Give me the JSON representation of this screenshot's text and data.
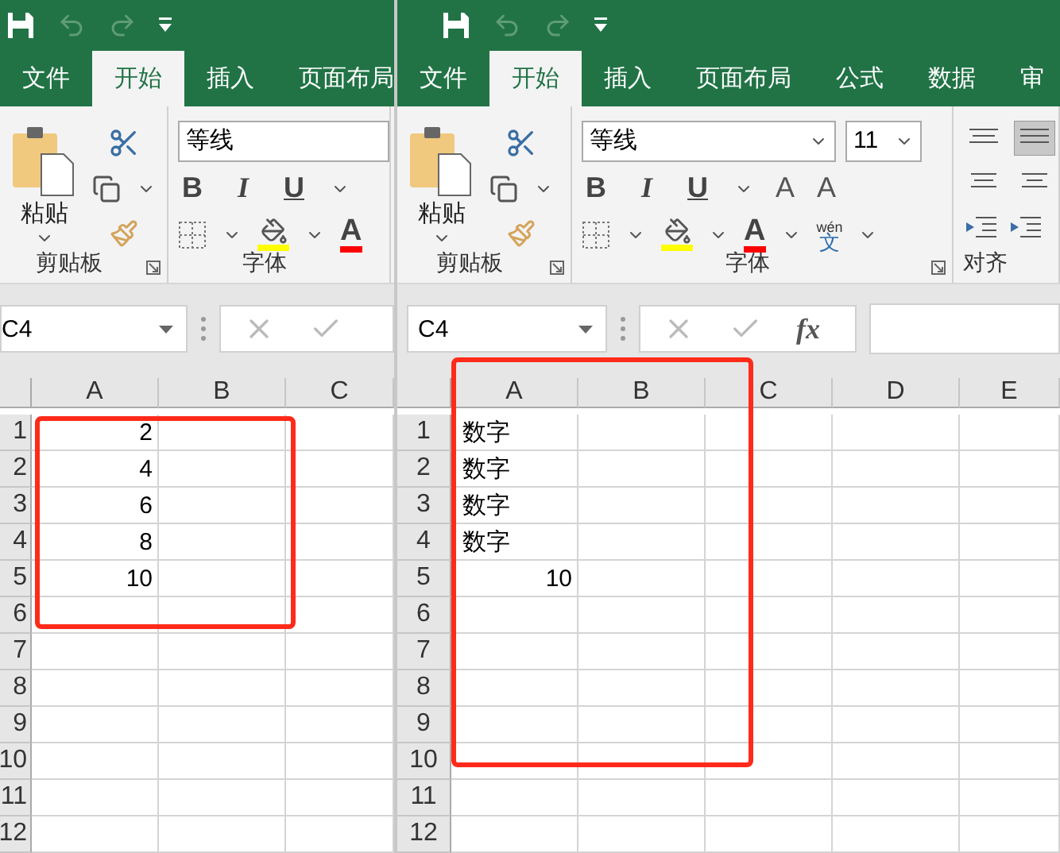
{
  "windows": [
    {
      "tabs": [
        {
          "label": "文件",
          "selected": false
        },
        {
          "label": "开始",
          "selected": true
        },
        {
          "label": "插入",
          "selected": false
        },
        {
          "label": "页面布局",
          "selected": false
        }
      ],
      "paste_label": "粘贴",
      "font_name": "等线",
      "format_buttons": [
        "B",
        "I",
        "U"
      ],
      "font_color_label": "A",
      "groups": [
        "剪贴板",
        "字体"
      ],
      "name_box": "C4",
      "columns": [
        "A",
        "B",
        "C"
      ],
      "rows": [
        {
          "header": "1",
          "cells": [
            {
              "value": "2",
              "kind": "number"
            }
          ]
        },
        {
          "header": "2",
          "cells": [
            {
              "value": "4",
              "kind": "number"
            }
          ]
        },
        {
          "header": "3",
          "cells": [
            {
              "value": "6",
              "kind": "number"
            }
          ]
        },
        {
          "header": "4",
          "cells": [
            {
              "value": "8",
              "kind": "number"
            }
          ]
        },
        {
          "header": "5",
          "cells": [
            {
              "value": "10",
              "kind": "number"
            }
          ]
        },
        {
          "header": "6"
        },
        {
          "header": "7"
        },
        {
          "header": "8"
        },
        {
          "header": "9"
        },
        {
          "header": "10"
        },
        {
          "header": "11"
        },
        {
          "header": "12"
        }
      ],
      "highlight": true
    },
    {
      "tabs": [
        {
          "label": "文件",
          "selected": false
        },
        {
          "label": "开始",
          "selected": true
        },
        {
          "label": "插入",
          "selected": false
        },
        {
          "label": "页面布局",
          "selected": false
        },
        {
          "label": "公式",
          "selected": false
        },
        {
          "label": "数据",
          "selected": false
        },
        {
          "label": "审",
          "selected": false
        }
      ],
      "paste_label": "粘贴",
      "font_name": "等线",
      "font_size": "11",
      "format_buttons": [
        "B",
        "I",
        "U"
      ],
      "grow_shrink": [
        "A",
        "A"
      ],
      "font_color_label": "A",
      "phonetic": {
        "top": "wén",
        "main": "文"
      },
      "groups": [
        "剪贴板",
        "字体",
        "对齐"
      ],
      "name_box": "C4",
      "fx_label": "fx",
      "columns": [
        "A",
        "B",
        "C",
        "D",
        "E"
      ],
      "rows": [
        {
          "header": "1",
          "cells": [
            {
              "value": "数字",
              "kind": "text"
            }
          ]
        },
        {
          "header": "2",
          "cells": [
            {
              "value": "数字",
              "kind": "text"
            }
          ]
        },
        {
          "header": "3",
          "cells": [
            {
              "value": "数字",
              "kind": "text"
            }
          ]
        },
        {
          "header": "4",
          "cells": [
            {
              "value": "数字",
              "kind": "text"
            }
          ]
        },
        {
          "header": "5",
          "cells": [
            {
              "value": "10",
              "kind": "number"
            }
          ]
        },
        {
          "header": "6"
        },
        {
          "header": "7"
        },
        {
          "header": "8"
        },
        {
          "header": "9"
        },
        {
          "header": "10"
        },
        {
          "header": "11"
        },
        {
          "header": "12"
        }
      ],
      "highlight": true
    }
  ]
}
